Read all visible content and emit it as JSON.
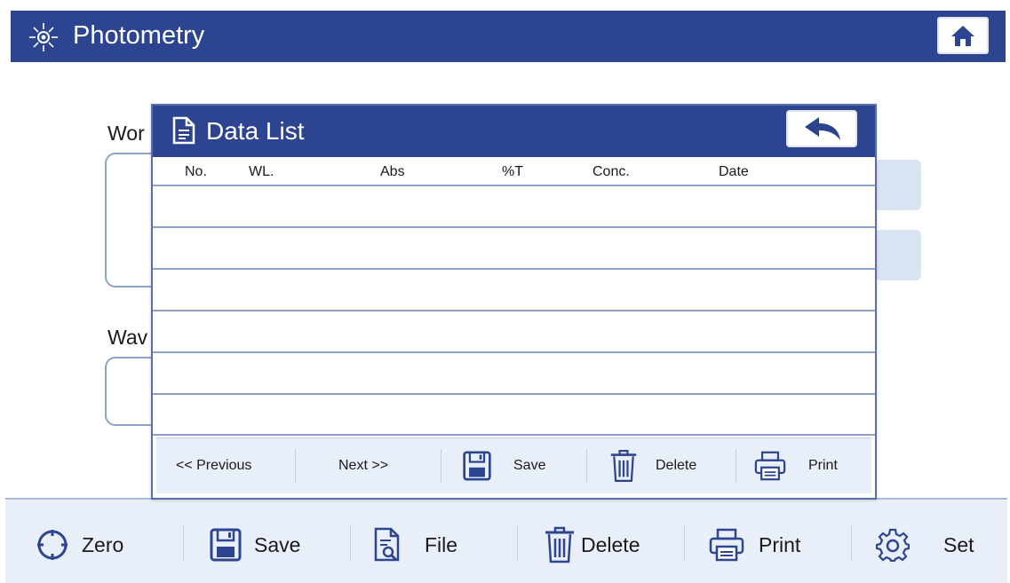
{
  "header": {
    "title": "Photometry",
    "sun_icon": "sun-icon",
    "home_icon": "home-icon"
  },
  "background_panel": {
    "label_1": "Wor",
    "label_2": "Wav"
  },
  "dialog": {
    "title": "Data List",
    "back_icon": "back-arrow-icon",
    "columns": [
      "No.",
      "WL.",
      "Abs",
      "%T",
      "Conc.",
      "Date"
    ],
    "rows": [
      [
        "",
        "",
        "",
        "",
        "",
        ""
      ],
      [
        "",
        "",
        "",
        "",
        "",
        ""
      ],
      [
        "",
        "",
        "",
        "",
        "",
        ""
      ],
      [
        "",
        "",
        "",
        "",
        "",
        ""
      ],
      [
        "",
        "",
        "",
        "",
        "",
        ""
      ],
      [
        "",
        "",
        "",
        "",
        "",
        ""
      ]
    ],
    "footer": {
      "previous": "<< Previous",
      "next": "Next >>",
      "save": "Save",
      "delete": "Delete",
      "print": "Print"
    }
  },
  "toolbar": {
    "zero": "Zero",
    "save": "Save",
    "file": "File",
    "delete": "Delete",
    "print": "Print",
    "set": "Set"
  },
  "colors": {
    "header_bg": "#2d4591",
    "toolbar_bg": "#e9eff8",
    "row_line": "#8fa1c6",
    "icon_blue": "#2d4591"
  }
}
